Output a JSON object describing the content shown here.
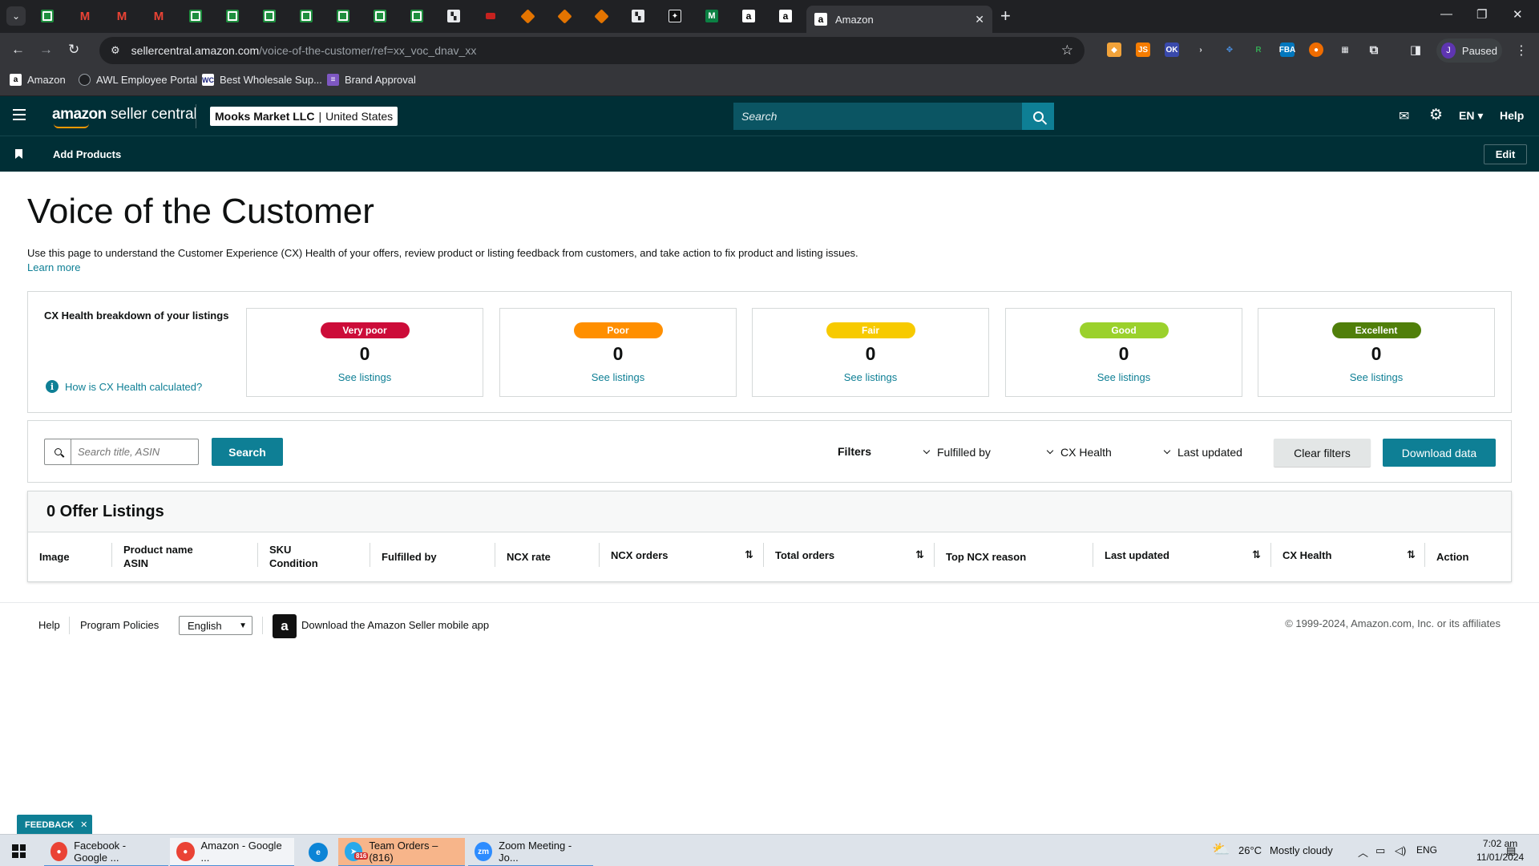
{
  "browser": {
    "active_tab_title": "Amazon",
    "url_host": "sellercentral.amazon.com",
    "url_path": "/voice-of-the-customer/ref=xx_voc_dnav_xx",
    "profile_initial": "J",
    "profile_status": "Paused",
    "bookmarks": [
      {
        "label": "Amazon"
      },
      {
        "label": "AWL Employee Portal"
      },
      {
        "label": "Best Wholesale Sup..."
      },
      {
        "label": "Brand Approval"
      }
    ]
  },
  "header": {
    "logo_bold": "amazon",
    "logo_rest": " seller central",
    "store_name": "Mooks Market LLC",
    "store_sep": "|",
    "store_region": "United States",
    "search_placeholder": "Search",
    "language": "EN",
    "help": "Help",
    "add_products": "Add Products",
    "edit": "Edit"
  },
  "page": {
    "title": "Voice of the Customer",
    "intro": "Use this page to understand the Customer Experience (CX) Health of your offers, review product or listing feedback from customers, and take action to fix product and listing issues.",
    "learn_more": "Learn more"
  },
  "cx": {
    "heading": "CX Health breakdown of your listings",
    "how_link": "How is CX Health calculated?",
    "cards": [
      {
        "label": "Very poor",
        "count": "0",
        "link": "See listings",
        "color": "#cc0c39"
      },
      {
        "label": "Poor",
        "count": "0",
        "link": "See listings",
        "color": "#ff8f00"
      },
      {
        "label": "Fair",
        "count": "0",
        "link": "See listings",
        "color": "#f7ca00"
      },
      {
        "label": "Good",
        "count": "0",
        "link": "See listings",
        "color": "#9bd12c"
      },
      {
        "label": "Excellent",
        "count": "0",
        "link": "See listings",
        "color": "#507f0a"
      }
    ]
  },
  "filters": {
    "search_placeholder": "Search title, ASIN",
    "search_button": "Search",
    "label": "Filters",
    "fulfilled_by": "Fulfilled by",
    "cx_health": "CX Health",
    "last_updated": "Last updated",
    "clear": "Clear filters",
    "download": "Download data"
  },
  "listings": {
    "title": "0 Offer Listings",
    "columns": {
      "image": "Image",
      "product_name": "Product name",
      "asin": "ASIN",
      "sku": "SKU",
      "condition": "Condition",
      "fulfilled_by": "Fulfilled by",
      "ncx_rate": "NCX rate",
      "ncx_orders": "NCX orders",
      "total_orders": "Total orders",
      "top_ncx_reason": "Top NCX reason",
      "last_updated": "Last updated",
      "cx_health": "CX Health",
      "action": "Action"
    }
  },
  "footer": {
    "help": "Help",
    "program_policies": "Program Policies",
    "language": "English",
    "app": "Download the Amazon Seller mobile app",
    "copyright": "© 1999-2024, Amazon.com, Inc. or its affiliates"
  },
  "feedback": "FEEDBACK",
  "taskbar": {
    "items": [
      {
        "label": "Facebook - Google ..."
      },
      {
        "label": "Amazon - Google ..."
      },
      {
        "label": "Team Orders – (816)"
      },
      {
        "label": "Zoom Meeting - Jo..."
      }
    ],
    "badge": "816",
    "weather_temp": "26°C",
    "weather_desc": "Mostly cloudy",
    "lang": "ENG",
    "time": "7:02 am",
    "date": "11/01/2024"
  }
}
